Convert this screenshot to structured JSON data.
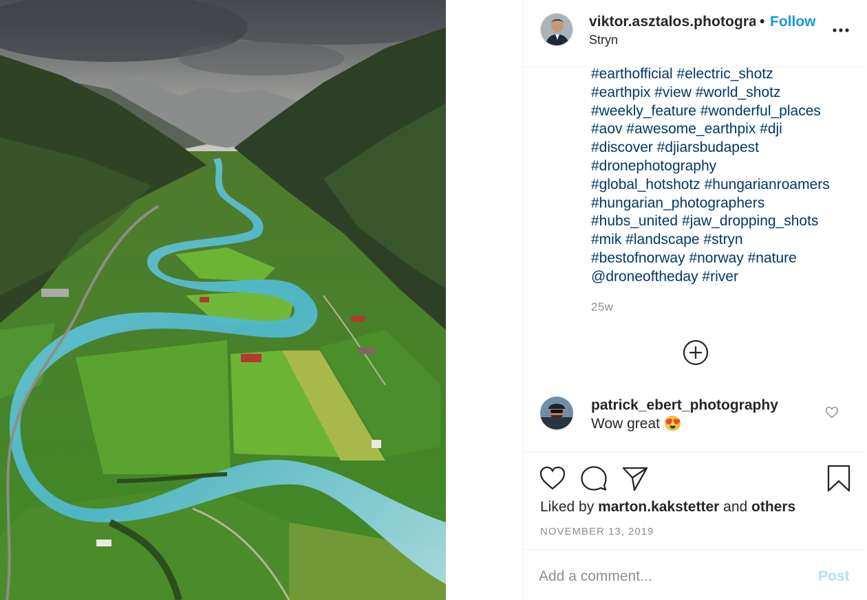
{
  "post": {
    "owner": {
      "username": "viktor.asztalos.photogra",
      "separator": "•",
      "follow_label": "Follow",
      "location": "Stryn",
      "avatar_icon": "user-avatar-icon"
    },
    "more_icon": "more-options-icon",
    "caption_tags": "#earthofficial #electric_shotz\n#earthpix #view #world_shotz\n#weekly_feature #wonderful_places\n#aov #awesome_earthpix #dji\n#discover #djiarsbudapest\n#dronephotography\n#global_hotshotz #hungarianroamers\n#hungarian_photographers\n#hubs_united #jaw_dropping_shots\n#mik #landscape #stryn\n#bestofnorway #norway #nature\n@droneoftheday #river",
    "age": "25w",
    "load_more_icon": "plus-circle-icon",
    "comments": [
      {
        "username": "patrick_ebert_photography",
        "text": "Wow great 😍",
        "like_icon": "heart-icon"
      }
    ],
    "actions": {
      "like_icon": "heart-icon",
      "comment_icon": "comment-icon",
      "share_icon": "paper-plane-icon",
      "save_icon": "bookmark-icon"
    },
    "likes": {
      "prefix": "Liked by",
      "user": "marton.kakstetter",
      "joiner": "and",
      "others": "others"
    },
    "date": "NOVEMBER 13, 2019",
    "add_comment": {
      "placeholder": "Add a comment...",
      "post_label": "Post"
    }
  },
  "colors": {
    "link_blue": "#1b95e0",
    "hashtag": "#00376b",
    "muted": "#8e8e8e",
    "post_disabled": "#b2dffc",
    "border": "#efefef"
  }
}
